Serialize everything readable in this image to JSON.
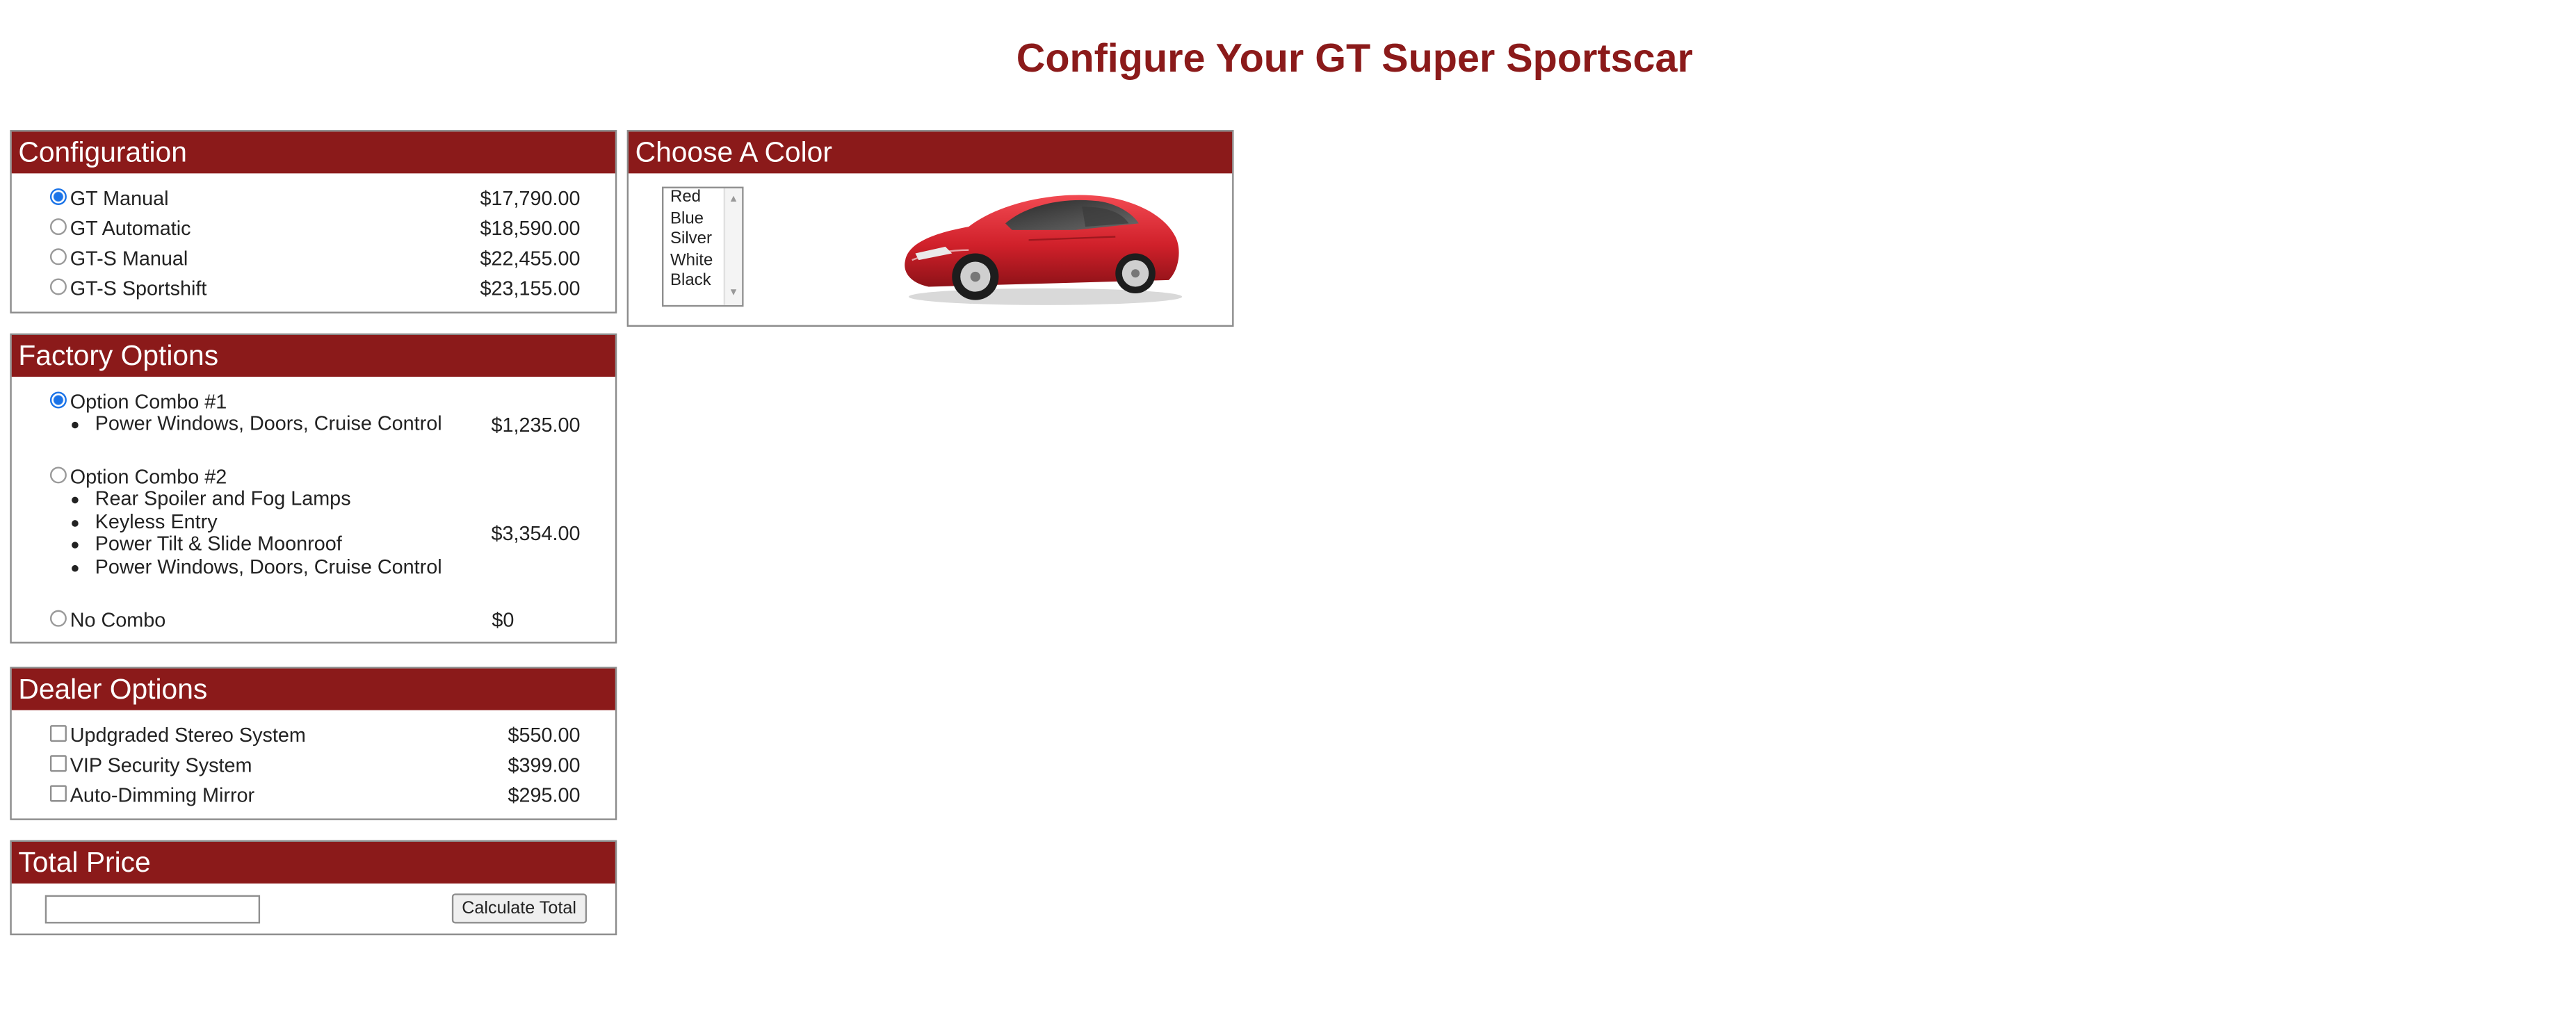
{
  "page": {
    "title": "Configure Your GT Super Sportscar"
  },
  "configuration": {
    "heading": "Configuration",
    "options": [
      {
        "label": "GT Manual",
        "price": "$17,790.00",
        "selected": true
      },
      {
        "label": "GT Automatic",
        "price": "$18,590.00",
        "selected": false
      },
      {
        "label": "GT-S Manual",
        "price": "$22,455.00",
        "selected": false
      },
      {
        "label": "GT-S Sportshift",
        "price": "$23,155.00",
        "selected": false
      }
    ]
  },
  "factory_options": {
    "heading": "Factory Options",
    "combos": [
      {
        "label": "Option Combo #1",
        "price": "$1,235.00",
        "selected": true,
        "features": [
          "Power Windows, Doors, Cruise Control"
        ]
      },
      {
        "label": "Option Combo #2",
        "price": "$3,354.00",
        "selected": false,
        "features": [
          "Rear Spoiler and Fog Lamps",
          "Keyless Entry",
          "Power Tilt & Slide Moonroof",
          "Power Windows, Doors, Cruise Control"
        ]
      },
      {
        "label": "No Combo",
        "price": "$0",
        "selected": false,
        "features": []
      }
    ]
  },
  "dealer_options": {
    "heading": "Dealer Options",
    "items": [
      {
        "label": "Updgraded Stereo System",
        "price": "$550.00",
        "checked": false
      },
      {
        "label": "VIP Security System",
        "price": "$399.00",
        "checked": false
      },
      {
        "label": "Auto-Dimming Mirror",
        "price": "$295.00",
        "checked": false
      }
    ]
  },
  "total_price": {
    "heading": "Total Price",
    "value": "",
    "button_label": "Calculate Total"
  },
  "color": {
    "heading": "Choose A Color",
    "options": [
      "Red",
      "Blue",
      "Silver",
      "White",
      "Black"
    ],
    "car_color": "#d0202a"
  },
  "colors": {
    "accent": "#8b1a1a",
    "radio_selected": "#1a73e8"
  }
}
